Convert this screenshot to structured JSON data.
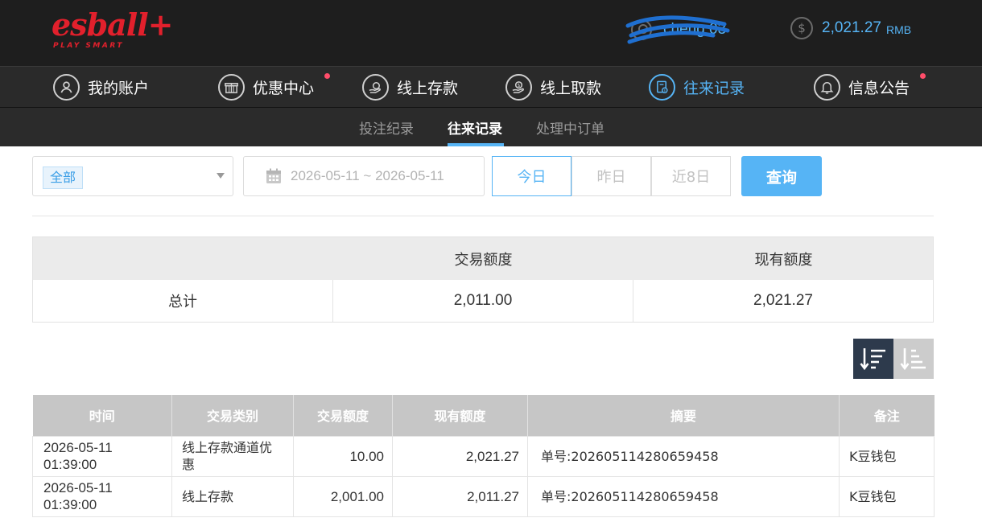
{
  "header": {
    "logo_word": "esball+",
    "logo_tagline": "PLAY SMART",
    "username": "cheng 03",
    "balance": "2,021.27",
    "currency": "RMB"
  },
  "colors": {
    "accent": "#56b4f5",
    "brand": "#e2202c",
    "notice_dot": "#ff4d6a",
    "header_bg": "#1e1e1e",
    "nav_bg": "#2a2a2a"
  },
  "nav": {
    "items": [
      {
        "label": "我的账户",
        "icon": "user-icon"
      },
      {
        "label": "优惠中心",
        "icon": "gift-icon",
        "dot": true
      },
      {
        "label": "线上存款",
        "icon": "deposit-icon"
      },
      {
        "label": "线上取款",
        "icon": "withdraw-icon"
      },
      {
        "label": "往来记录",
        "icon": "record-icon",
        "active": true
      },
      {
        "label": "信息公告",
        "icon": "bell-icon",
        "dot": true
      }
    ]
  },
  "subnav": {
    "tabs": [
      {
        "label": "投注纪录"
      },
      {
        "label": "往来记录",
        "active": true
      },
      {
        "label": "处理中订单"
      }
    ]
  },
  "filter": {
    "type_selected": "全部",
    "date_range": "2026-05-11 ~ 2026-05-11",
    "quick_today": "今日",
    "quick_yesterday": "昨日",
    "quick_8days": "近8日",
    "query": "查询"
  },
  "summary": {
    "col_amount": "交易额度",
    "col_balance": "现有额度",
    "row_label": "总计",
    "total_amount": "2,011.00",
    "total_balance": "2,021.27"
  },
  "table": {
    "headers": [
      "时间",
      "交易类别",
      "交易额度",
      "现有额度",
      "摘要",
      "备注"
    ],
    "rows": [
      {
        "time": "2026-05-11 01:39:00",
        "type": "线上存款通道优惠",
        "amount": "10.00",
        "balance": "2,021.27",
        "memo": "单号:202605114280659458",
        "note": "K豆钱包"
      },
      {
        "time": "2026-05-11 01:39:00",
        "type": "线上存款",
        "amount": "2,001.00",
        "balance": "2,011.27",
        "memo": "单号:202605114280659458",
        "note": "K豆钱包"
      }
    ]
  }
}
